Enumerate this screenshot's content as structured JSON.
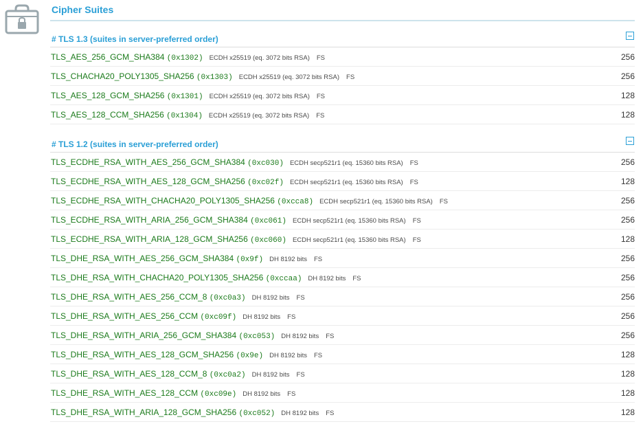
{
  "section": {
    "title": "Cipher Suites",
    "icon": "lock-icon"
  },
  "colors": {
    "accent": "#2a9fd6",
    "suite_name": "#1a7a1a",
    "icon_gray": "#9aa7ad"
  },
  "groups": [
    {
      "title": "# TLS 1.3 (suites in server-preferred order)",
      "suites": [
        {
          "name": "TLS_AES_256_GCM_SHA384",
          "code": "(0x1302)",
          "kex": "ECDH x25519 (eq. 3072 bits RSA)",
          "fs": "FS",
          "bits": "256"
        },
        {
          "name": "TLS_CHACHA20_POLY1305_SHA256",
          "code": "(0x1303)",
          "kex": "ECDH x25519 (eq. 3072 bits RSA)",
          "fs": "FS",
          "bits": "256"
        },
        {
          "name": "TLS_AES_128_GCM_SHA256",
          "code": "(0x1301)",
          "kex": "ECDH x25519 (eq. 3072 bits RSA)",
          "fs": "FS",
          "bits": "128"
        },
        {
          "name": "TLS_AES_128_CCM_SHA256",
          "code": "(0x1304)",
          "kex": "ECDH x25519 (eq. 3072 bits RSA)",
          "fs": "FS",
          "bits": "128"
        }
      ]
    },
    {
      "title": "# TLS 1.2 (suites in server-preferred order)",
      "suites": [
        {
          "name": "TLS_ECDHE_RSA_WITH_AES_256_GCM_SHA384",
          "code": "(0xc030)",
          "kex": "ECDH secp521r1 (eq. 15360 bits RSA)",
          "fs": "FS",
          "bits": "256"
        },
        {
          "name": "TLS_ECDHE_RSA_WITH_AES_128_GCM_SHA256",
          "code": "(0xc02f)",
          "kex": "ECDH secp521r1 (eq. 15360 bits RSA)",
          "fs": "FS",
          "bits": "128"
        },
        {
          "name": "TLS_ECDHE_RSA_WITH_CHACHA20_POLY1305_SHA256",
          "code": "(0xcca8)",
          "kex": "ECDH secp521r1 (eq. 15360 bits RSA)",
          "fs": "FS",
          "bits": "256"
        },
        {
          "name": "TLS_ECDHE_RSA_WITH_ARIA_256_GCM_SHA384",
          "code": "(0xc061)",
          "kex": "ECDH secp521r1 (eq. 15360 bits RSA)",
          "fs": "FS",
          "bits": "256"
        },
        {
          "name": "TLS_ECDHE_RSA_WITH_ARIA_128_GCM_SHA256",
          "code": "(0xc060)",
          "kex": "ECDH secp521r1 (eq. 15360 bits RSA)",
          "fs": "FS",
          "bits": "128"
        },
        {
          "name": "TLS_DHE_RSA_WITH_AES_256_GCM_SHA384",
          "code": "(0x9f)",
          "kex": "DH 8192 bits",
          "fs": "FS",
          "bits": "256"
        },
        {
          "name": "TLS_DHE_RSA_WITH_CHACHA20_POLY1305_SHA256",
          "code": "(0xccaa)",
          "kex": "DH 8192 bits",
          "fs": "FS",
          "bits": "256"
        },
        {
          "name": "TLS_DHE_RSA_WITH_AES_256_CCM_8",
          "code": "(0xc0a3)",
          "kex": "DH 8192 bits",
          "fs": "FS",
          "bits": "256"
        },
        {
          "name": "TLS_DHE_RSA_WITH_AES_256_CCM",
          "code": "(0xc09f)",
          "kex": "DH 8192 bits",
          "fs": "FS",
          "bits": "256"
        },
        {
          "name": "TLS_DHE_RSA_WITH_ARIA_256_GCM_SHA384",
          "code": "(0xc053)",
          "kex": "DH 8192 bits",
          "fs": "FS",
          "bits": "256"
        },
        {
          "name": "TLS_DHE_RSA_WITH_AES_128_GCM_SHA256",
          "code": "(0x9e)",
          "kex": "DH 8192 bits",
          "fs": "FS",
          "bits": "128"
        },
        {
          "name": "TLS_DHE_RSA_WITH_AES_128_CCM_8",
          "code": "(0xc0a2)",
          "kex": "DH 8192 bits",
          "fs": "FS",
          "bits": "128"
        },
        {
          "name": "TLS_DHE_RSA_WITH_AES_128_CCM",
          "code": "(0xc09e)",
          "kex": "DH 8192 bits",
          "fs": "FS",
          "bits": "128"
        },
        {
          "name": "TLS_DHE_RSA_WITH_ARIA_128_GCM_SHA256",
          "code": "(0xc052)",
          "kex": "DH 8192 bits",
          "fs": "FS",
          "bits": "128"
        }
      ]
    }
  ]
}
